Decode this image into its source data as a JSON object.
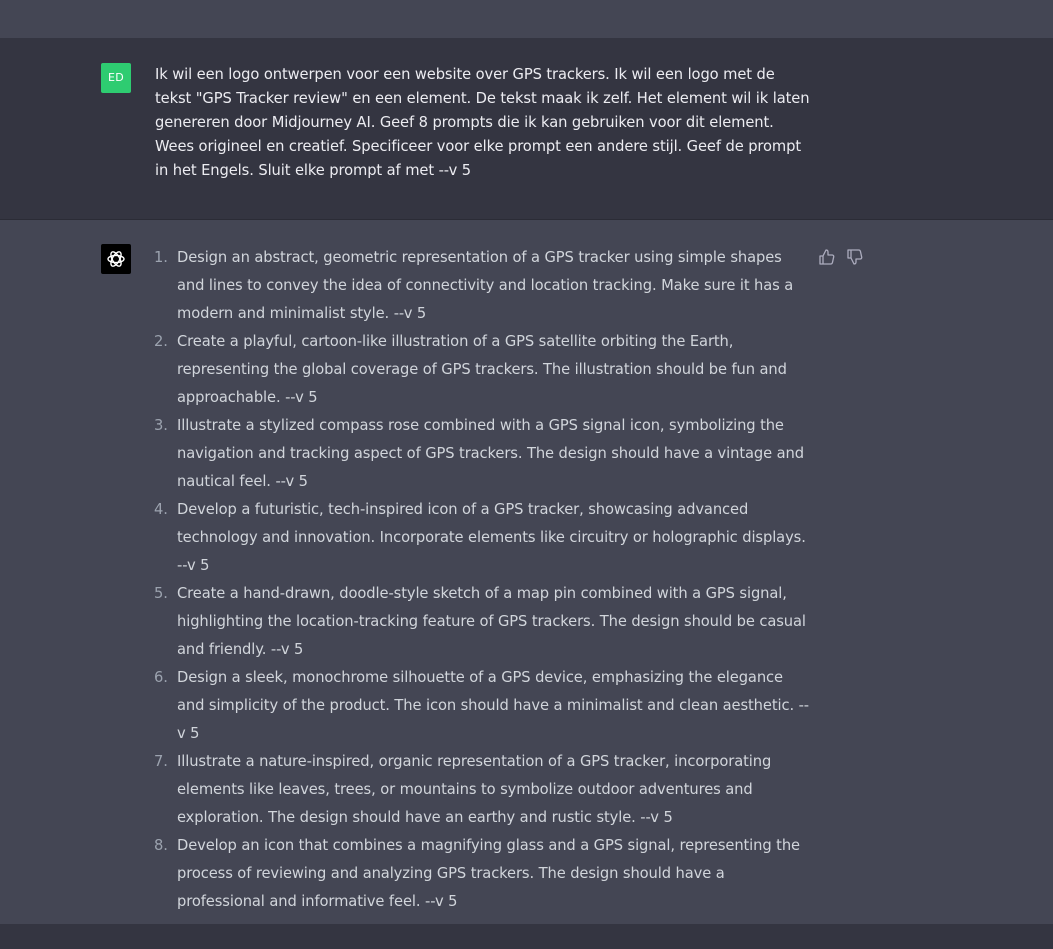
{
  "user": {
    "initials": "ED",
    "avatar_color": "#2ecc71",
    "message": "Ik wil een logo ontwerpen voor een website over GPS trackers. Ik wil een logo met de tekst \"GPS Tracker review\" en een element. De tekst maak ik zelf. Het element wil ik laten genereren door Midjourney AI. Geef 8 prompts die ik kan gebruiken voor dit element. Wees origineel en creatief. Specificeer voor elke prompt een andere stijl. Geef de prompt in het Engels. Sluit elke prompt af met --v 5"
  },
  "assistant": {
    "icon": "openai-logo-icon",
    "feedback_icons": [
      "thumbs-up-icon",
      "thumbs-down-icon"
    ],
    "items": [
      {
        "num": "1.",
        "text": "Design an abstract, geometric representation of a GPS tracker using simple shapes and lines to convey the idea of connectivity and location tracking. Make sure it has a modern and minimalist style. --v 5"
      },
      {
        "num": "2.",
        "text": "Create a playful, cartoon-like illustration of a GPS satellite orbiting the Earth, representing the global coverage of GPS trackers. The illustration should be fun and approachable. --v 5"
      },
      {
        "num": "3.",
        "text": "Illustrate a stylized compass rose combined with a GPS signal icon, symbolizing the navigation and tracking aspect of GPS trackers. The design should have a vintage and nautical feel. --v 5"
      },
      {
        "num": "4.",
        "text": "Develop a futuristic, tech-inspired icon of a GPS tracker, showcasing advanced technology and innovation. Incorporate elements like circuitry or holographic displays. --v 5"
      },
      {
        "num": "5.",
        "text": "Create a hand-drawn, doodle-style sketch of a map pin combined with a GPS signal, highlighting the location-tracking feature of GPS trackers. The design should be casual and friendly. --v 5"
      },
      {
        "num": "6.",
        "text": "Design a sleek, monochrome silhouette of a GPS device, emphasizing the elegance and simplicity of the product. The icon should have a minimalist and clean aesthetic. --v 5"
      },
      {
        "num": "7.",
        "text": "Illustrate a nature-inspired, organic representation of a GPS tracker, incorporating elements like leaves, trees, or mountains to symbolize outdoor adventures and exploration. The design should have an earthy and rustic style. --v 5"
      },
      {
        "num": "8.",
        "text": "Develop an icon that combines a magnifying glass and a GPS signal, representing the process of reviewing and analyzing GPS trackers. The design should have a professional and informative feel. --v 5"
      }
    ]
  },
  "colors": {
    "user_bg": "#343541",
    "assistant_bg": "#444654",
    "text": "#d1d5db"
  }
}
